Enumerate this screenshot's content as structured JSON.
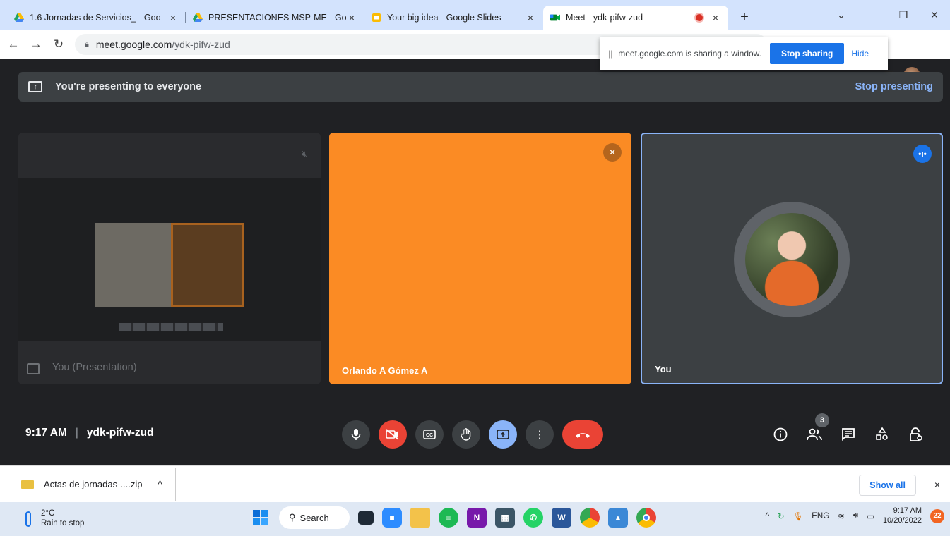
{
  "browser": {
    "tabs": [
      {
        "title": "1.6 Jornadas de Servicios_ - Goo",
        "icon": "google-drive-icon"
      },
      {
        "title": "PRESENTACIONES MSP-ME - Goo",
        "icon": "google-drive-icon"
      },
      {
        "title": "Your big idea - Google Slides",
        "icon": "google-slides-icon"
      },
      {
        "title": "Meet - ydk-pifw-zud",
        "icon": "google-meet-icon",
        "active": true
      }
    ],
    "tab_close": "×",
    "new_tab": "+",
    "url_domain": "meet.google.com",
    "url_path": "/ydk-pifw-zud"
  },
  "share_notice": {
    "text": "meet.google.com is sharing a window.",
    "stop_label": "Stop sharing",
    "hide_label": "Hide"
  },
  "meet": {
    "banner_text": "You're presenting to everyone",
    "stop_presenting": "Stop presenting",
    "tiles": [
      {
        "name": "You (Presentation)"
      },
      {
        "name": "Orlando A Gómez A"
      },
      {
        "name": "You"
      }
    ],
    "time": "9:17 AM",
    "separator": "|",
    "meeting_code": "ydk-pifw-zud",
    "participant_count": "3"
  },
  "downloads": {
    "file_name": "Actas de jornadas-....zip",
    "show_all": "Show all",
    "close": "×"
  },
  "taskbar": {
    "temperature": "2°C",
    "weather_text": "Rain to stop",
    "search_label": "Search",
    "language": "ENG",
    "clock_time": "9:17 AM",
    "clock_date": "10/20/2022",
    "notification_count": "22"
  },
  "colors": {
    "meet_bg": "#202124",
    "orlando_tile": "#fb8b24",
    "accent_blue": "#8ab4f8",
    "end_call_red": "#ea4335"
  }
}
